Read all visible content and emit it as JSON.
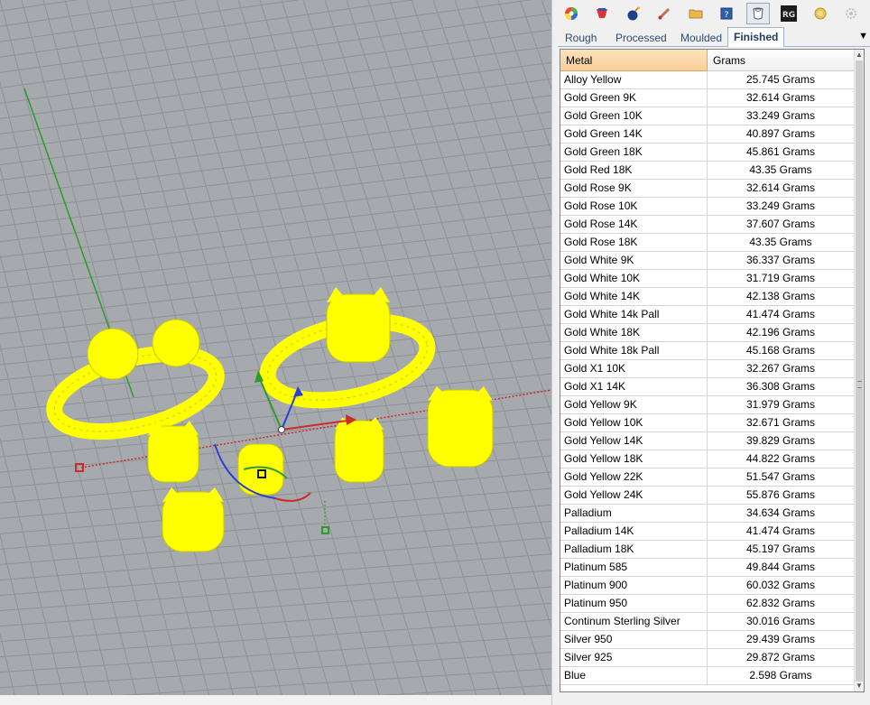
{
  "viewport": {
    "name": "3D perspective viewport"
  },
  "toolbar": {
    "icons": [
      "color-wheel-icon",
      "render-icon",
      "bomb-icon",
      "brush-icon",
      "folder-icon",
      "help-book-icon",
      "ring-weight-icon",
      "rg-logo-icon",
      "gold-coin-icon",
      "settings-icon"
    ]
  },
  "tabs": [
    {
      "label": "Rough"
    },
    {
      "label": "Processed"
    },
    {
      "label": "Moulded"
    },
    {
      "label": "Finished"
    }
  ],
  "tab_menu_glyph": "▼",
  "table": {
    "headers": {
      "metal": "Metal",
      "grams": "Grams"
    },
    "rows": [
      {
        "metal": "Alloy Yellow",
        "grams": "25.745 Grams"
      },
      {
        "metal": "Gold Green 9K",
        "grams": "32.614 Grams"
      },
      {
        "metal": "Gold Green 10K",
        "grams": "33.249 Grams"
      },
      {
        "metal": "Gold Green 14K",
        "grams": "40.897 Grams"
      },
      {
        "metal": "Gold Green 18K",
        "grams": "45.861 Grams"
      },
      {
        "metal": "Gold Red 18K",
        "grams": "43.35 Grams"
      },
      {
        "metal": "Gold Rose 9K",
        "grams": "32.614 Grams"
      },
      {
        "metal": "Gold Rose 10K",
        "grams": "33.249 Grams"
      },
      {
        "metal": "Gold Rose 14K",
        "grams": "37.607 Grams"
      },
      {
        "metal": "Gold Rose 18K",
        "grams": "43.35 Grams"
      },
      {
        "metal": "Gold White 9K",
        "grams": "36.337 Grams"
      },
      {
        "metal": "Gold White 10K",
        "grams": "31.719 Grams"
      },
      {
        "metal": "Gold White 14K",
        "grams": "42.138 Grams"
      },
      {
        "metal": "Gold White 14k Pall",
        "grams": "41.474 Grams"
      },
      {
        "metal": "Gold White 18K",
        "grams": "42.196 Grams"
      },
      {
        "metal": "Gold White 18k Pall",
        "grams": "45.168 Grams"
      },
      {
        "metal": "Gold X1 10K",
        "grams": "32.267 Grams"
      },
      {
        "metal": "Gold X1 14K",
        "grams": "36.308 Grams"
      },
      {
        "metal": "Gold Yellow 9K",
        "grams": "31.979 Grams"
      },
      {
        "metal": "Gold Yellow 10K",
        "grams": "32.671 Grams"
      },
      {
        "metal": "Gold Yellow 14K",
        "grams": "39.829 Grams"
      },
      {
        "metal": "Gold Yellow 18K",
        "grams": "44.822 Grams"
      },
      {
        "metal": "Gold Yellow 22K",
        "grams": "51.547 Grams"
      },
      {
        "metal": "Gold Yellow 24K",
        "grams": "55.876 Grams"
      },
      {
        "metal": "Palladium",
        "grams": "34.634 Grams"
      },
      {
        "metal": "Palladium 14K",
        "grams": "41.474 Grams"
      },
      {
        "metal": "Palladium 18K",
        "grams": "45.197 Grams"
      },
      {
        "metal": "Platinum 585",
        "grams": "49.844 Grams"
      },
      {
        "metal": "Platinum 900",
        "grams": "60.032 Grams"
      },
      {
        "metal": "Platinum 950",
        "grams": "62.832 Grams"
      },
      {
        "metal": "Continum Sterling Silver",
        "grams": "30.016 Grams"
      },
      {
        "metal": "Silver 950",
        "grams": "29.439 Grams"
      },
      {
        "metal": "Silver 925",
        "grams": "29.872 Grams"
      },
      {
        "metal": "Blue",
        "grams": "2.598 Grams"
      }
    ]
  },
  "colors": {
    "viewport_bg": "#a6aaae",
    "grid_line": "#8e9296",
    "model_yellow": "#ffff00",
    "active_header": "#f9cf97",
    "tab_text": "#2b4a73",
    "x_axis": "#cc2b2b",
    "y_axis": "#2e9a2e",
    "z_axis": "#2a3fd6"
  }
}
